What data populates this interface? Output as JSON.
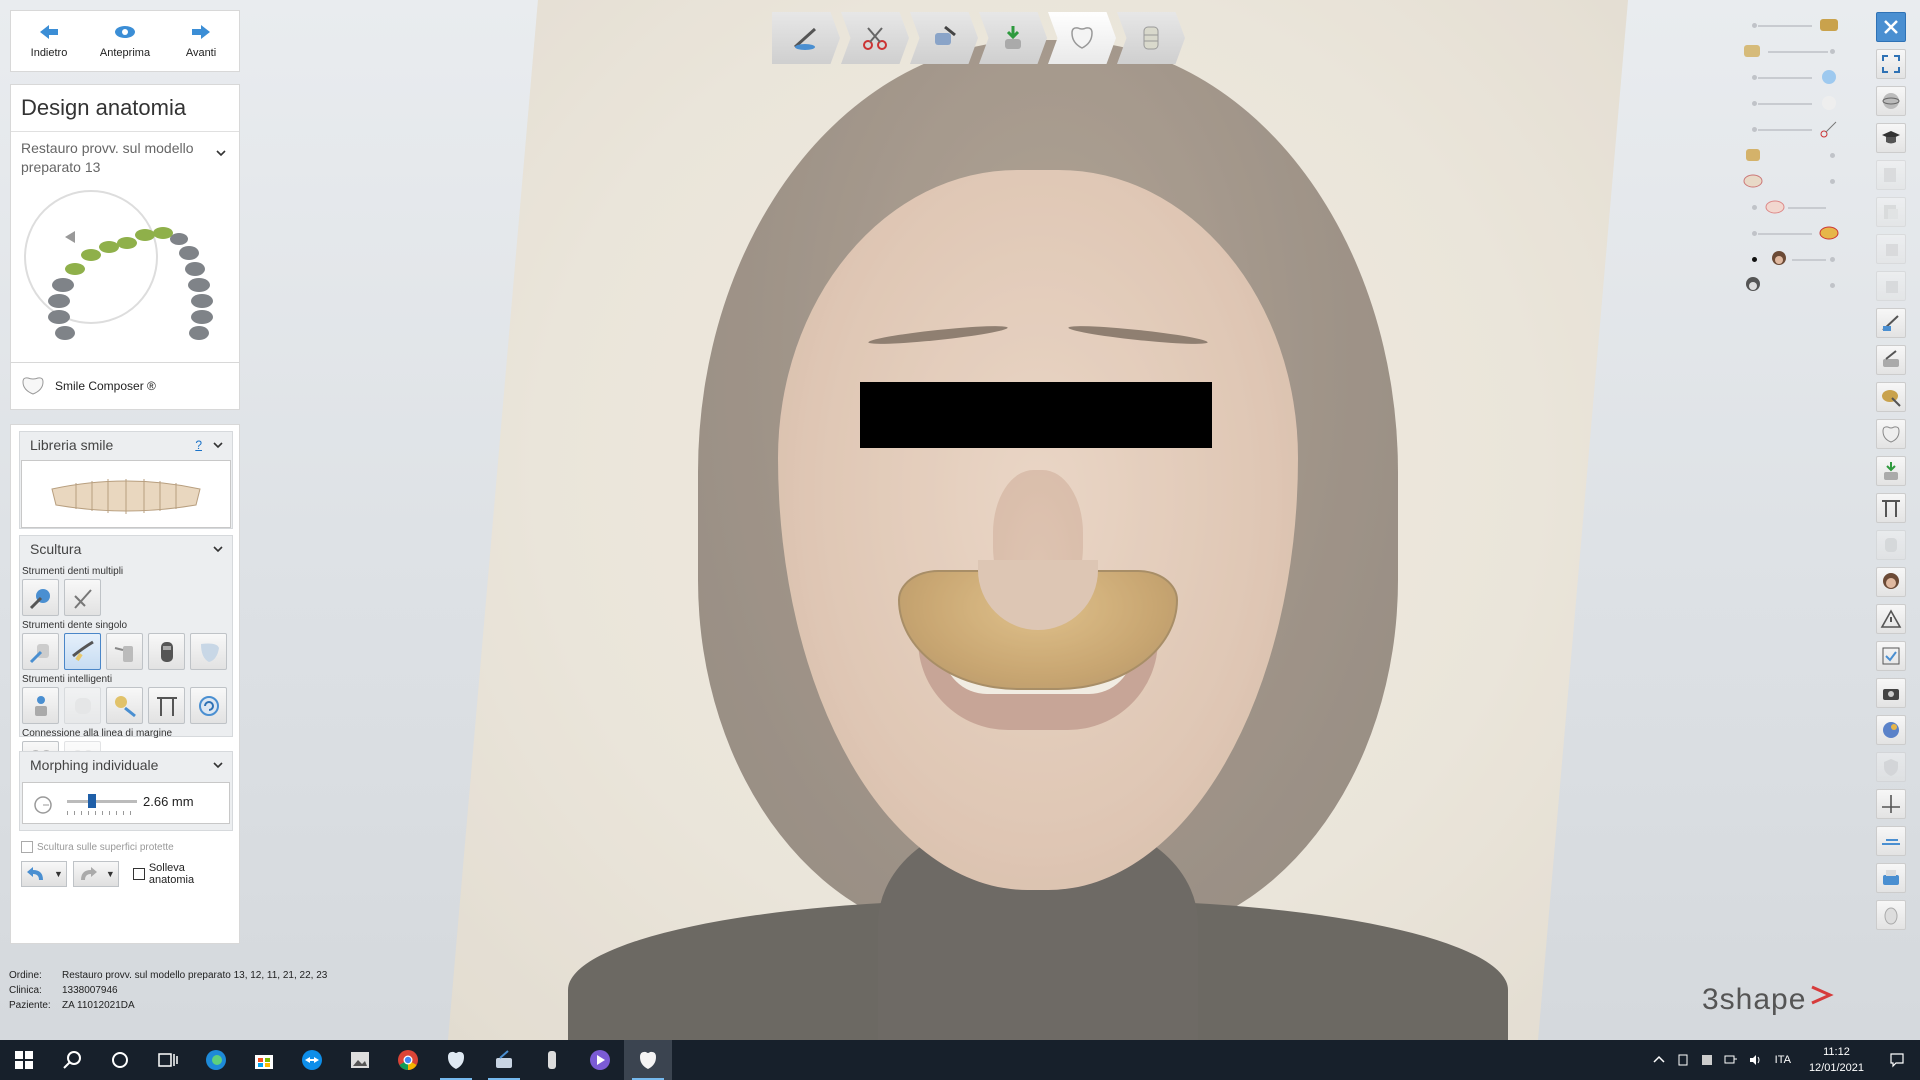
{
  "navigation": {
    "back_label": "Indietro",
    "preview_label": "Anteprima",
    "forward_label": "Avanti"
  },
  "design": {
    "title": "Design anatomia",
    "subtitle": "Restauro provv. sul modello preparato 13"
  },
  "smile_composer": {
    "label": "Smile Composer ®"
  },
  "library": {
    "title": "Libreria smile",
    "help": "?"
  },
  "sculpt": {
    "title": "Scultura",
    "multi_label": "Strumenti denti multipli",
    "single_label": "Strumenti dente singolo",
    "smart_label": "Strumenti intelligenti",
    "margin_label": "Connessione alla linea di margine"
  },
  "morph": {
    "title": "Morphing individuale",
    "value": "2.66 mm",
    "level": 0.35,
    "protected_label": "Scultura sulle superfici protette",
    "lift_label": "Solleva anatomia"
  },
  "order": {
    "order_key": "Ordine:",
    "order_value": "Restauro provv. sul modello preparato 13, 12, 11, 21, 22, 23",
    "clinic_key": "Clinica:",
    "clinic_value": "1338007946",
    "patient_key": "Paziente:",
    "patient_value": "ZA 11012021DA"
  },
  "brand": {
    "name": "3shape"
  },
  "taskbar": {
    "language": "ITA",
    "time": "11:12",
    "date": "12/01/2021"
  },
  "colors": {
    "accent": "#1f5fa8",
    "crown_gold": "#c49a55",
    "taskbar": "#17202b"
  },
  "icons": {
    "top_steps": [
      "margin-line-icon",
      "cut-scissors-icon",
      "insertion-direction-icon",
      "placement-icon",
      "anatomy-tooth-icon",
      "connector-icon"
    ],
    "right_bar": [
      "close-icon",
      "fullscreen-icon",
      "view-3d-icon",
      "training-cap-icon"
    ]
  }
}
